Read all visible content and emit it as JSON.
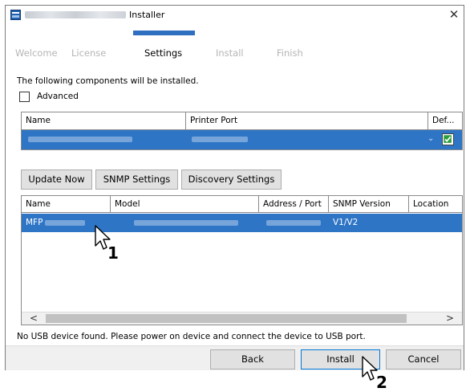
{
  "window": {
    "title": "Installer",
    "close_glyph": "✕"
  },
  "steps": [
    {
      "label": "Welcome",
      "active": false
    },
    {
      "label": "License",
      "active": false
    },
    {
      "label": "Settings",
      "active": true
    },
    {
      "label": "Install",
      "active": false
    },
    {
      "label": "Finish",
      "active": false
    }
  ],
  "settings": {
    "intro": "The following components will be installed.",
    "advanced_label": "Advanced",
    "advanced_checked": false
  },
  "components_table": {
    "columns": [
      "Name",
      "Printer Port",
      "Def..."
    ],
    "row": {
      "default_checked": true
    }
  },
  "actions": {
    "update_now": "Update Now",
    "snmp_settings": "SNMP Settings",
    "discovery_settings": "Discovery Settings"
  },
  "devices_table": {
    "columns": [
      "Name",
      "Model",
      "Address / Port",
      "SNMP Version",
      "Location"
    ],
    "rows": [
      {
        "name": "MFP",
        "snmp_version": "V1/V2"
      }
    ],
    "scroll_left": "<",
    "scroll_right": ">"
  },
  "status": "No USB device found. Please power on device and connect the device to USB port.",
  "footer": {
    "back": "Back",
    "install": "Install",
    "cancel": "Cancel"
  },
  "callouts": {
    "first": "1",
    "second": "2"
  },
  "colors": {
    "selection": "#2e75c6",
    "step_indicator": "#2e6fc0",
    "inactive_step": "#b5b5b5"
  }
}
